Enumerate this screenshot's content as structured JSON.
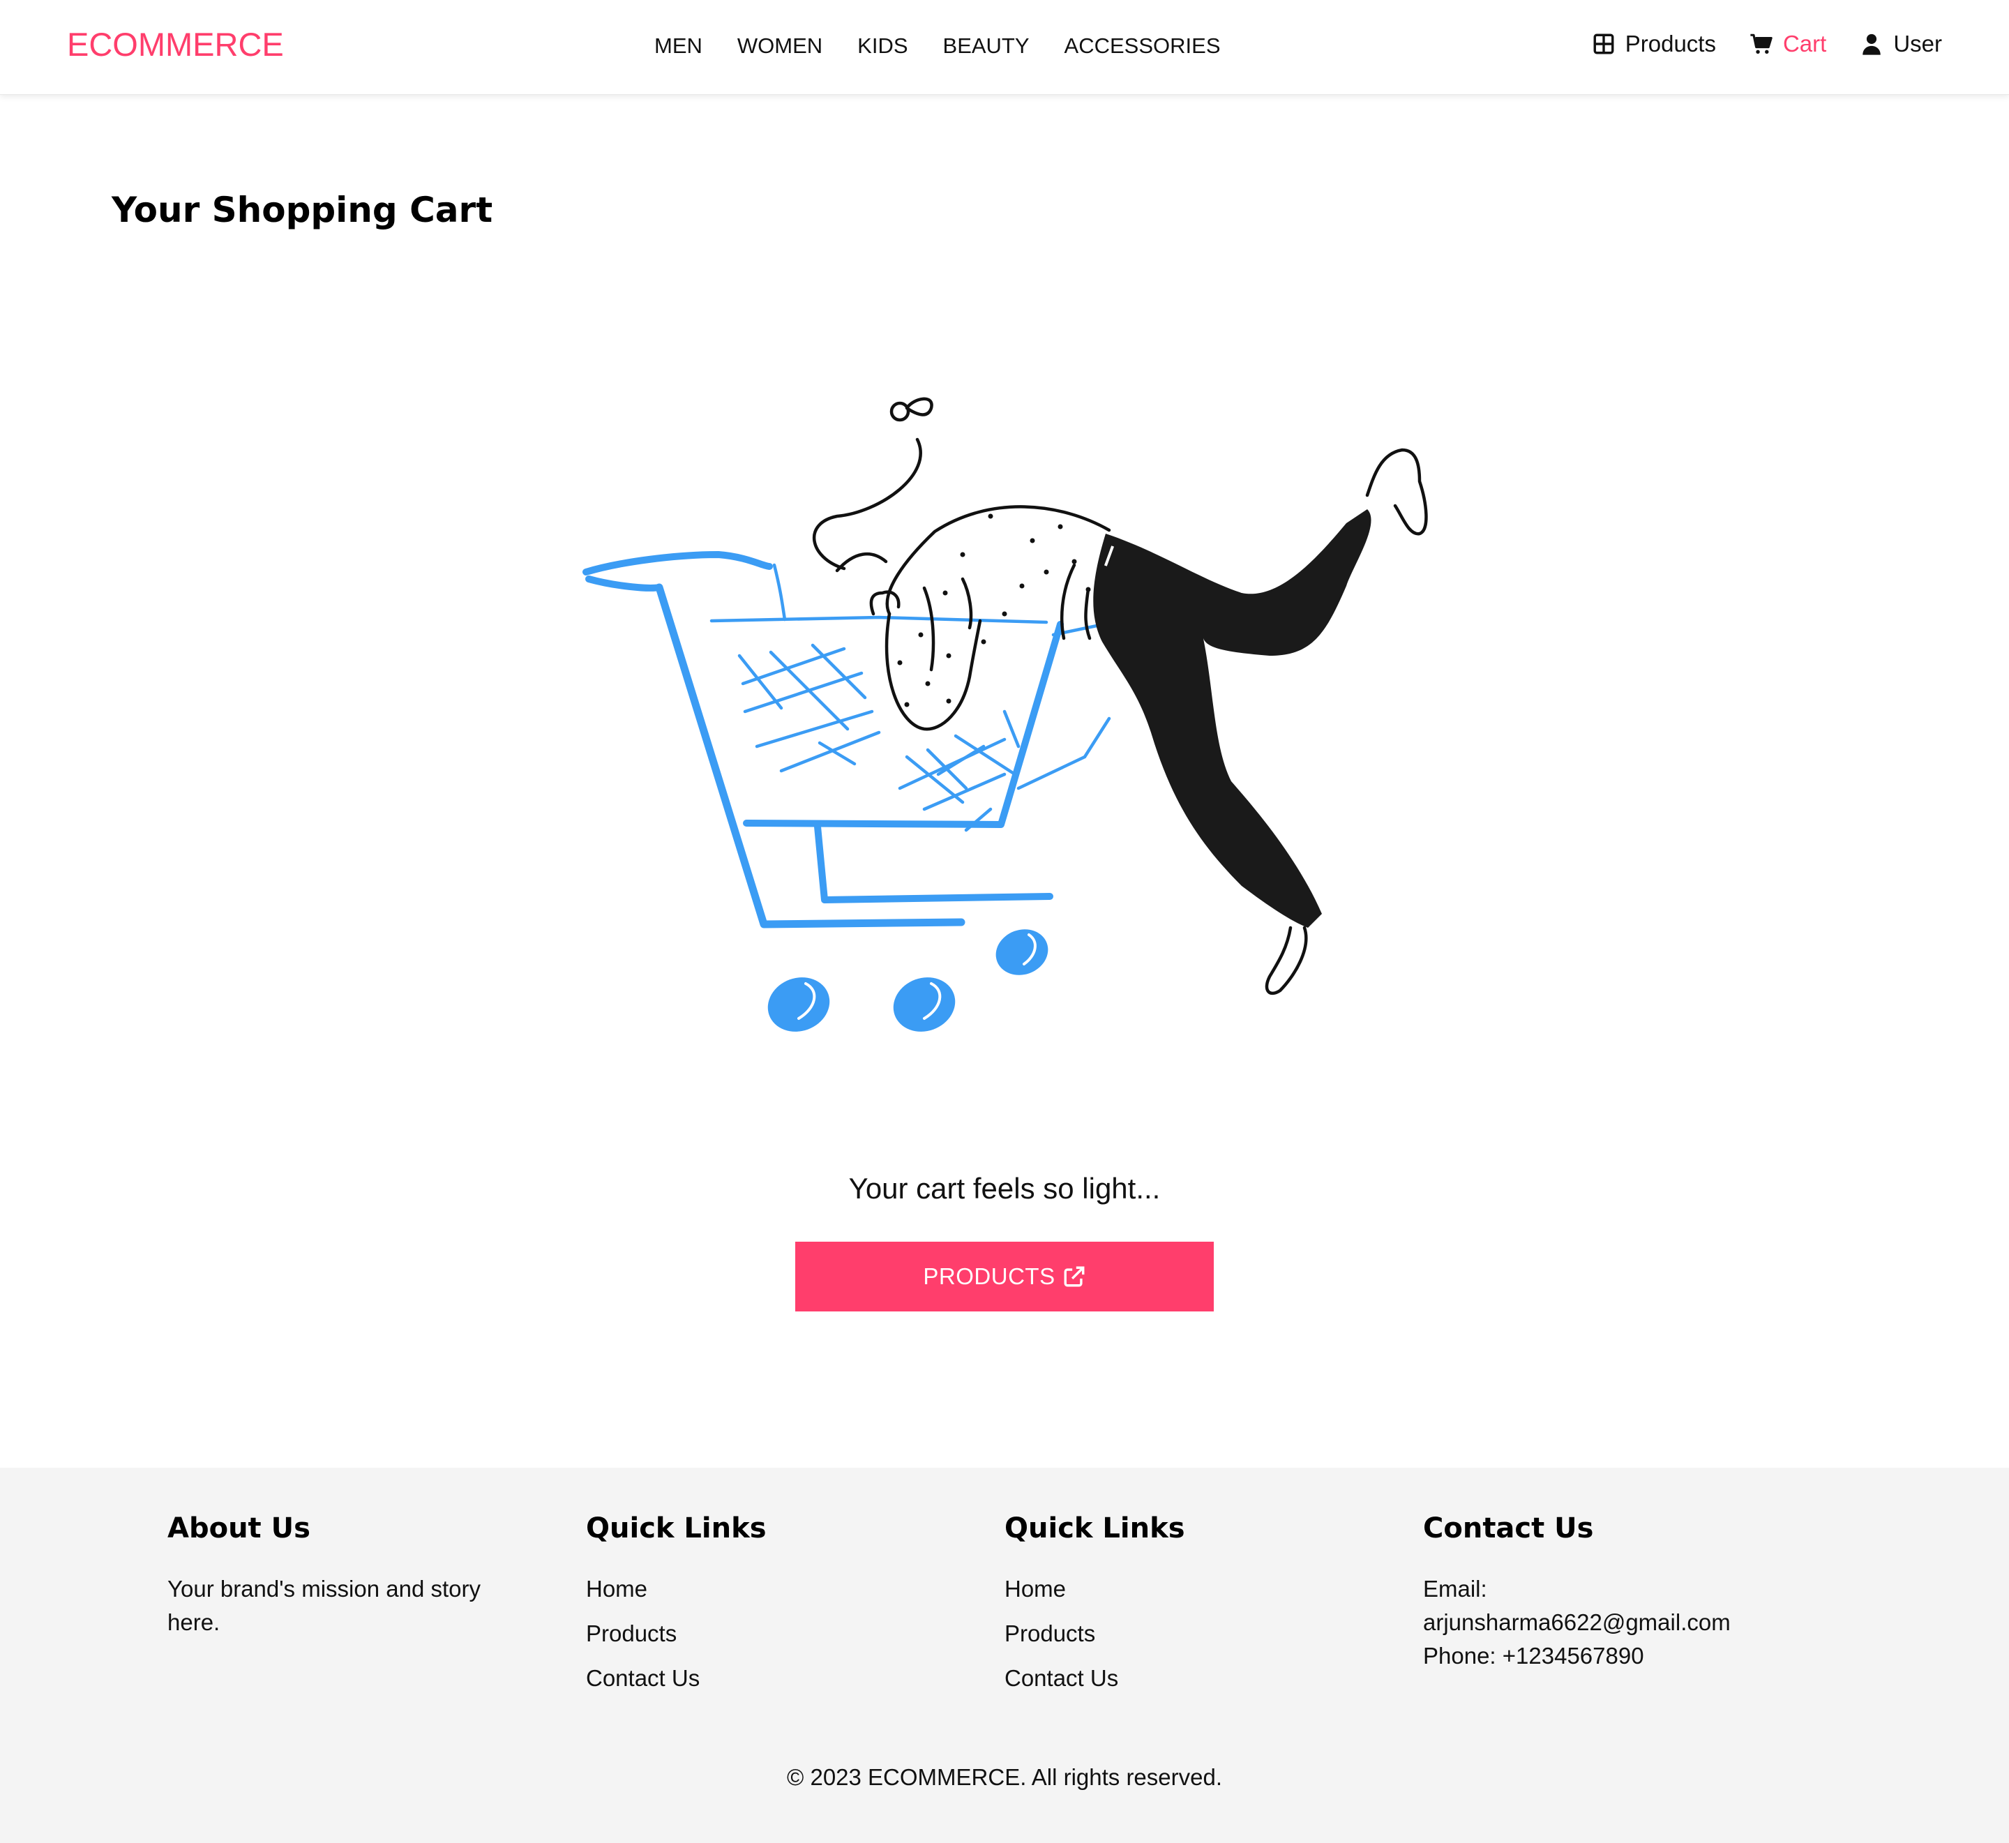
{
  "brand": "ECOMMERCE",
  "nav": {
    "links": [
      "MEN",
      "WOMEN",
      "KIDS",
      "BEAUTY",
      "ACCESSORIES"
    ],
    "products_label": "Products",
    "cart_label": "Cart",
    "user_label": "User"
  },
  "colors": {
    "accent": "#ff3e6c",
    "illustration_blue": "#3b9cf4",
    "footer_bg": "#f4f4f4"
  },
  "main": {
    "title": "Your Shopping Cart",
    "empty_message": "Your cart feels so light...",
    "products_button": "PRODUCTS"
  },
  "footer": {
    "about": {
      "heading": "About Us",
      "text": "Your brand's mission and story here."
    },
    "quick_links_1": {
      "heading": "Quick Links",
      "links": [
        "Home",
        "Products",
        "Contact Us"
      ]
    },
    "quick_links_2": {
      "heading": "Quick Links",
      "links": [
        "Home",
        "Products",
        "Contact Us"
      ]
    },
    "contact": {
      "heading": "Contact Us",
      "email_label": "Email:",
      "email": "arjunsharma6622@gmail.com",
      "phone": "Phone: +1234567890"
    },
    "copyright": "© 2023 ECOMMERCE. All rights reserved."
  }
}
